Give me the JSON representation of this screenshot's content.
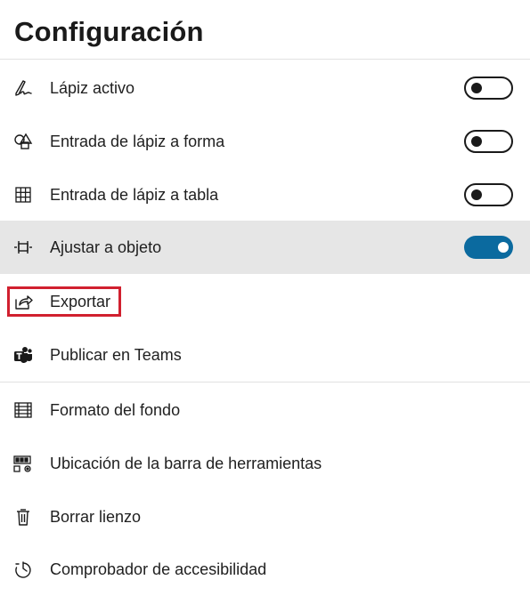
{
  "panel": {
    "title": "Configuración"
  },
  "items": [
    {
      "label": "Lápiz activo",
      "icon": "pen-icon",
      "toggle": false
    },
    {
      "label": "Entrada de lápiz a forma",
      "icon": "shapes-icon",
      "toggle": false
    },
    {
      "label": "Entrada de lápiz a tabla",
      "icon": "table-icon",
      "toggle": false
    },
    {
      "label": "Ajustar a objeto",
      "icon": "snap-icon",
      "toggle": true
    },
    {
      "label": "Exportar",
      "icon": "share-icon"
    },
    {
      "label": "Publicar en Teams",
      "icon": "teams-icon"
    },
    {
      "label": "Formato del fondo",
      "icon": "grid-icon"
    },
    {
      "label": "Ubicación de la barra de herramientas",
      "icon": "toolbar-icon"
    },
    {
      "label": "Borrar lienzo",
      "icon": "trash-icon"
    },
    {
      "label": "Comprobador de accesibilidad",
      "icon": "accessibility-icon"
    }
  ],
  "colors": {
    "toggle_on": "#0b6a9f",
    "highlight_row": "#e6e6e6",
    "focus_outline": "#d1202f"
  }
}
